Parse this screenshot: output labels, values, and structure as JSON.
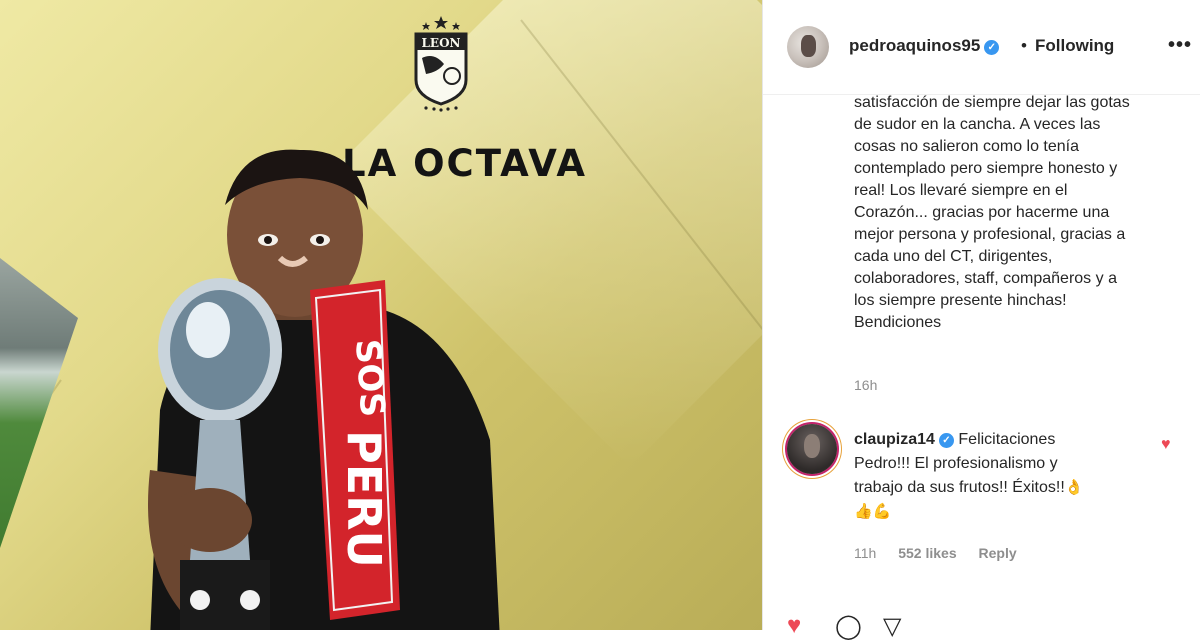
{
  "photo": {
    "headline": "LA OCTAVA",
    "crest_text": "LEON",
    "scarf_text_upper": "SOS",
    "scarf_text_lower": "PERU",
    "colors": {
      "background": "#e2d98a",
      "scarf": "#d3242b"
    }
  },
  "post": {
    "username": "pedroaquinos95",
    "verified_mark": "✓",
    "separator": "•",
    "follow_status": "Following",
    "more_icon": "•••",
    "caption_lines": [
      "satisfacción de siempre dejar las gotas",
      "de sudor en la cancha. A veces las",
      "cosas no salieron como lo tenía",
      "contemplado pero siempre honesto y",
      "real! Los llevaré siempre en el",
      "Corazón... gracias por hacerme una",
      "mejor persona y profesional, gracias a",
      "cada uno del CT, dirigentes,",
      "colaboradores, staff, compañeros y a",
      "los siempre presente hinchas!",
      "Bendiciones"
    ],
    "caption_time": "16h",
    "comment": {
      "username": "claupiza14",
      "verified_mark": "✓",
      "text_lines": [
        "Felicitaciones",
        "Pedro!!! El profesionalismo y",
        "trabajo da sus frutos!! Éxitos!!"
      ],
      "emoji_line1": "👌",
      "emoji_line2": "👍💪",
      "time": "11h",
      "likes": "552 likes",
      "reply": "Reply",
      "heart_icon": "♥"
    },
    "actions": {
      "like_icon": "♥",
      "comment_icon": "◯",
      "share_icon": "▽"
    },
    "accent_colors": {
      "verified": "#3897f0",
      "like": "#ed4956"
    }
  }
}
